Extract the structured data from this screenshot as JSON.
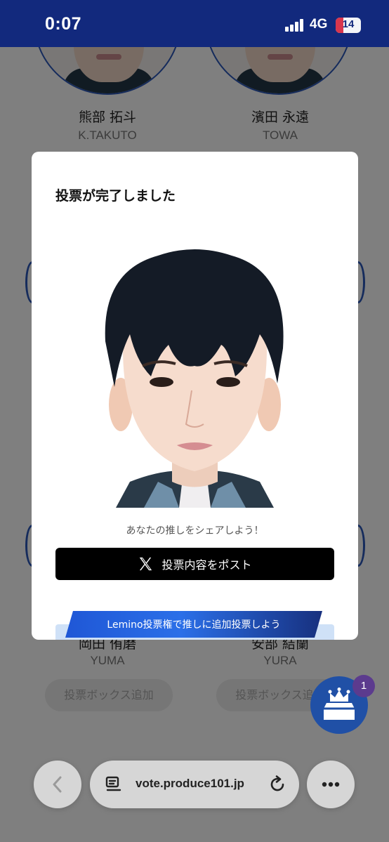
{
  "status_bar": {
    "time": "0:07",
    "network": "4G",
    "battery": "14"
  },
  "candidates_top": [
    {
      "name": "熊部 拓斗",
      "roman": "K.TAKUTO"
    },
    {
      "name": "濱田 永遠",
      "roman": "TOWA"
    }
  ],
  "candidates_bottom": [
    {
      "name": "岡田 侑磨",
      "roman": "YUMA",
      "button": "投票ボックス追加"
    },
    {
      "name": "安部 結蘭",
      "roman": "YURA",
      "button": "投票ボックス追加"
    }
  ],
  "modal": {
    "title": "投票が完了しました",
    "share_text": "あなたの推しをシェアしよう！",
    "post_button": "投票内容をポスト",
    "lemino_banner": "Lemino投票権で推しに追加投票しよう"
  },
  "vote_box": {
    "badge_count": "1"
  },
  "browser": {
    "url": "vote.produce101.jp"
  },
  "colors": {
    "header": "#12297d",
    "accent": "#2050a6",
    "badge": "#5c3b8e"
  }
}
